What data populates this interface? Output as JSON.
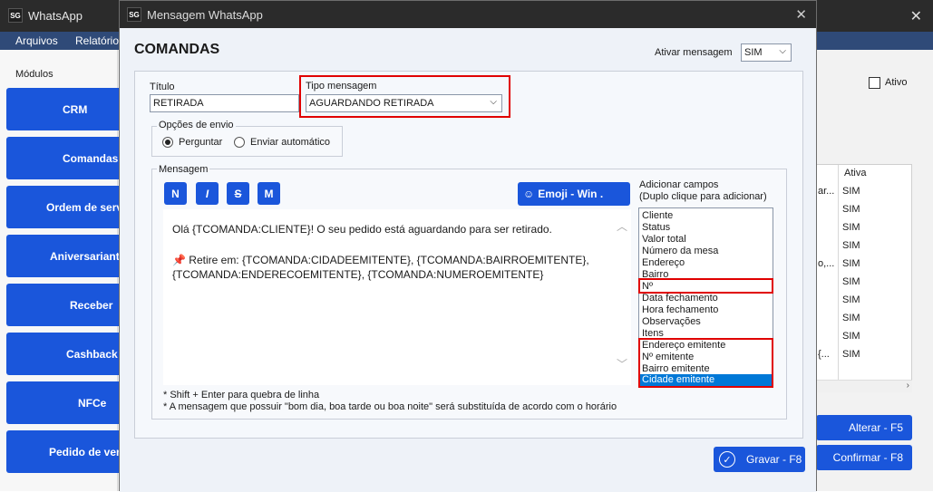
{
  "app": {
    "title": "WhatsApp",
    "logo": "SG",
    "menu": [
      "Arquivos",
      "Relatório"
    ],
    "modules_label": "Módulos",
    "modules": [
      "CRM",
      "Comandas",
      "Ordem de serviço",
      "Aniversariantes",
      "Receber",
      "Cashback",
      "NFCe",
      "Pedido de venda"
    ],
    "ativo_label": "Ativo",
    "table": {
      "column_header": "Ativa",
      "rows": [
        {
          "left": "ar...",
          "value": "SIM"
        },
        {
          "left": "",
          "value": "SIM"
        },
        {
          "left": "",
          "value": "SIM"
        },
        {
          "left": "",
          "value": "SIM"
        },
        {
          "left": "o,...",
          "value": "SIM"
        },
        {
          "left": "",
          "value": "SIM"
        },
        {
          "left": "",
          "value": "SIM"
        },
        {
          "left": "",
          "value": "SIM"
        },
        {
          "left": "",
          "value": "SIM"
        },
        {
          "left": "{...",
          "value": "SIM"
        }
      ]
    },
    "alterar_label": "Alterar - F5",
    "confirmar_label": "Confirmar - F8"
  },
  "dialog": {
    "title": "Mensagem WhatsApp",
    "logo": "SG",
    "heading": "COMANDAS",
    "ativar_label": "Ativar mensagem",
    "ativar_value": "SIM",
    "titulo_label": "Título",
    "titulo_value": "RETIRADA",
    "tipo_label": "Tipo mensagem",
    "tipo_value": "AGUARDANDO RETIRADA",
    "opcoes_label": "Opções de envio",
    "radio_perguntar": "Perguntar",
    "radio_auto": "Enviar automático",
    "mensagem_label": "Mensagem",
    "format_buttons": [
      "N",
      "I",
      "S",
      "M"
    ],
    "emoji_label": "Emoji - Win  .",
    "message_line1": "Olá {TCOMANDA:CLIENTE}! O seu pedido está aguardando para ser retirado.",
    "message_line2": "Retire em: {TCOMANDA:CIDADEEMITENTE}, {TCOMANDA:BAIRROEMITENTE},",
    "message_line3": "{TCOMANDA:ENDERECOEMITENTE}, {TCOMANDA:NUMEROEMITENTE}",
    "hint1": "* Shift + Enter para quebra de linha",
    "hint2": "* A mensagem que possuir \"bom dia, boa tarde ou boa noite\" será substituída de acordo com o horário",
    "campos_label1": "Adicionar campos",
    "campos_label2": "(Duplo clique para adicionar)",
    "campos": [
      "Cliente",
      "Status",
      "Valor total",
      "Número da mesa",
      "Endereço",
      "Bairro",
      "Nº",
      "Data fechamento",
      "Hora fechamento",
      "Observações",
      "Itens",
      "Endereço emitente",
      "Nº emitente",
      "Bairro emitente",
      "Cidade emitente"
    ],
    "selected_campo": "Cidade emitente",
    "gravar_label": "Gravar - F8"
  },
  "colors": {
    "accent": "#1a56db",
    "highlight": "#e00000",
    "selection": "#0078d7"
  }
}
